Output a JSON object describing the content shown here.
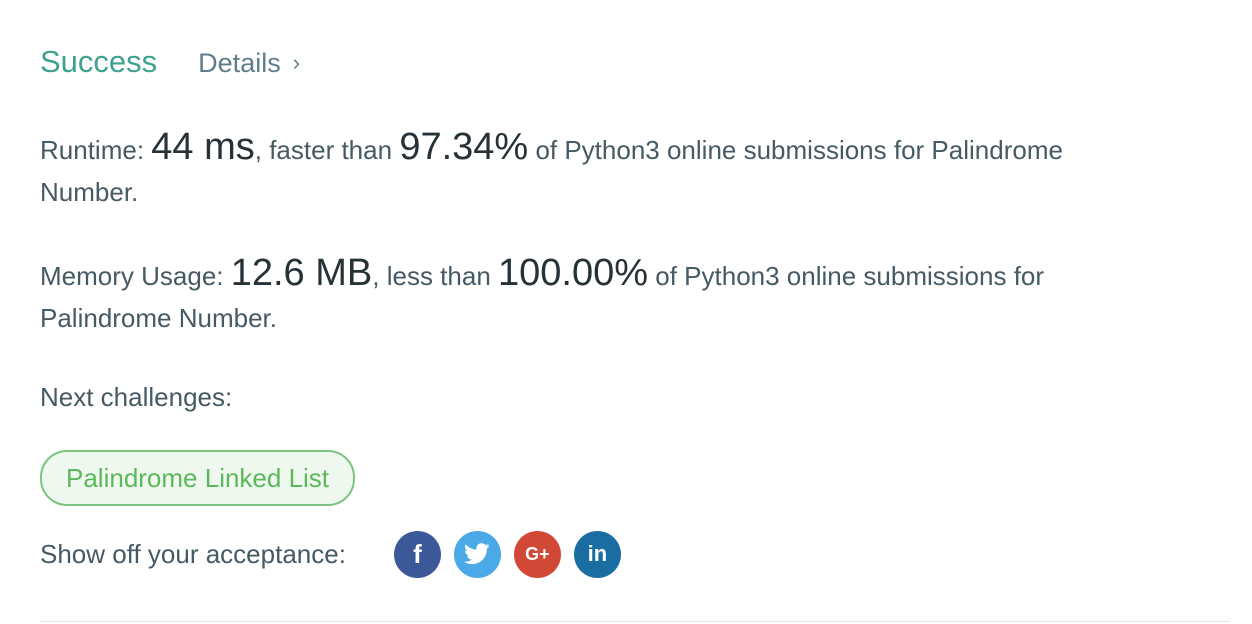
{
  "header": {
    "status": "Success",
    "details_label": "Details",
    "details_chevron": "›"
  },
  "runtime": {
    "label": "Runtime:",
    "value": "44 ms",
    "comparison": ", faster than",
    "percent": "97.34%",
    "suffix": "of Python3 online submissions for Palindrome Number."
  },
  "memory": {
    "label": "Memory Usage:",
    "value": "12.6 MB",
    "comparison": ", less than",
    "percent": "100.00%",
    "suffix": "of Python3 online submissions for Palindrome Number."
  },
  "next": {
    "label": "Next challenges:",
    "challenges": [
      "Palindrome Linked List"
    ]
  },
  "share": {
    "label": "Show off your acceptance:",
    "icons": [
      {
        "name": "facebook-icon",
        "glyph": "f",
        "color": "#3b5998"
      },
      {
        "name": "twitter-icon",
        "glyph": "",
        "color": "#4aa9e6"
      },
      {
        "name": "google-plus-icon",
        "glyph": "G+",
        "color": "#d14836"
      },
      {
        "name": "linkedin-icon",
        "glyph": "in",
        "color": "#1a6da0"
      }
    ]
  },
  "colors": {
    "success": "#3fa291",
    "challenge_border": "#7cc47f",
    "challenge_text": "#5cb85c"
  }
}
